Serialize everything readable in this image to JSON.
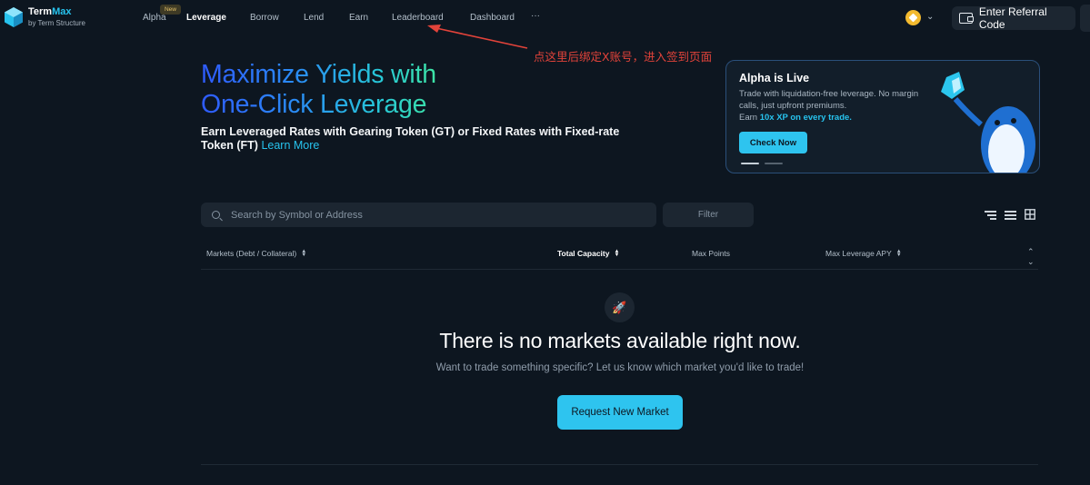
{
  "brand": {
    "name_part1": "Term",
    "name_part2": "Max",
    "subtitle": "by Term Structure"
  },
  "nav": {
    "items": [
      {
        "label": "Alpha"
      },
      {
        "label": "Leverage",
        "active": true
      },
      {
        "label": "Borrow"
      },
      {
        "label": "Lend"
      },
      {
        "label": "Earn"
      },
      {
        "label": "Leaderboard"
      },
      {
        "label": "Dashboard"
      },
      {
        "label": "···"
      }
    ],
    "badge": "New"
  },
  "header": {
    "referral_label": "Enter Referral Code"
  },
  "annotation": {
    "text": "点这里后绑定X账号，进入签到页面",
    "color": "#e2433a"
  },
  "hero": {
    "title_line1": "Maximize Yields with",
    "title_line2": "One-Click Leverage",
    "subtitle": "Earn Leveraged Rates with Gearing Token (GT) or Fixed Rates with Fixed-rate Token (FT)",
    "link": "Learn More"
  },
  "promo": {
    "title": "Alpha is Live",
    "desc": "Trade with liquidation-free leverage. No margin calls, just upfront premiums.",
    "earn_prefix": "Earn",
    "earn_highlight": "10x XP on every trade.",
    "button": "Check Now"
  },
  "controls": {
    "search_placeholder": "Search by Symbol or Address",
    "filter_label": "Filter"
  },
  "table": {
    "columns": [
      {
        "label": "Markets (Debt / Collateral)"
      },
      {
        "label": "Total Capacity"
      },
      {
        "label": "Max Points"
      },
      {
        "label": "Max Leverage APY"
      }
    ]
  },
  "empty": {
    "title": "There is no markets available right now.",
    "subtitle": "Want to trade something specific? Let us know which market you'd like to trade!",
    "button": "Request New Market"
  },
  "colors": {
    "accent": "#2ec4ef",
    "background": "#0d1620",
    "surface": "#1c2631"
  }
}
